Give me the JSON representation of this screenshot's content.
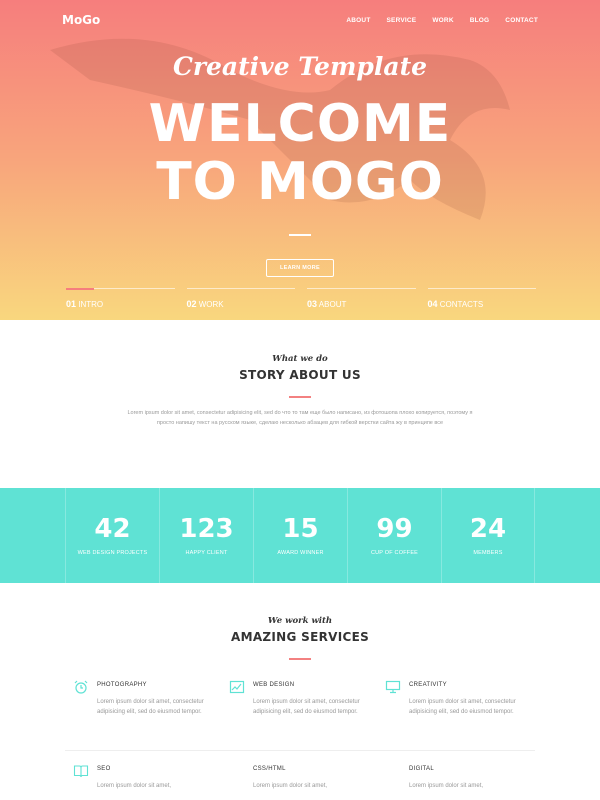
{
  "nav": {
    "logo": "MoGo",
    "items": [
      "ABOUT",
      "SERVICE",
      "WORK",
      "BLOG",
      "CONTACT"
    ]
  },
  "hero": {
    "subtitle": "Creative Template",
    "headline_line1": "WELCOME",
    "headline_line2": "TO MOGO",
    "button": "LEARN MORE",
    "slides": [
      {
        "num": "01",
        "label": "INTRO",
        "active": true
      },
      {
        "num": "02",
        "label": "WORK",
        "active": false
      },
      {
        "num": "03",
        "label": "ABOUT",
        "active": false
      },
      {
        "num": "04",
        "label": "CONTACTS",
        "active": false
      }
    ]
  },
  "about": {
    "script": "What we do",
    "title": "STORY ABOUT US",
    "text": "Lorem ipsum dolor sit amet, consectetur adipisicing elit, sed do что то там еще было написано, из фотошопа плохо копируется, поэтому я просто напишу текст на русском языке, сделаю несколько абзацев для гибкой верстки сайта жу в принципе все"
  },
  "stats": [
    {
      "num": "42",
      "caption": "WEB DESIGN PROJECTS"
    },
    {
      "num": "123",
      "caption": "HAPPY CLIENT"
    },
    {
      "num": "15",
      "caption": "AWARD WINNER"
    },
    {
      "num": "99",
      "caption": "CUP OF COFFEE"
    },
    {
      "num": "24",
      "caption": "MEMBERS"
    }
  ],
  "services": {
    "script": "We work with",
    "title": "AMAZING SERVICES",
    "items": [
      {
        "icon": "alarm-clock-icon",
        "title": "PHOTOGRAPHY",
        "desc": "Lorem ipsum dolor sit amet, consectetur adipisicing elit, sed do eiusmod tempor."
      },
      {
        "icon": "chart-icon",
        "title": "WEB DESIGN",
        "desc": "Lorem ipsum dolor sit amet, consectetur adipisicing elit, sed do eiusmod tempor."
      },
      {
        "icon": "monitor-icon",
        "title": "CREATIVITY",
        "desc": "Lorem ipsum dolor sit amet, consectetur adipisicing elit, sed do eiusmod tempor."
      },
      {
        "icon": "book-icon",
        "title": "SEO",
        "desc": "Lorem ipsum dolor sit amet,"
      },
      {
        "icon": "",
        "title": "CSS/HTML",
        "desc": "Lorem ipsum dolor sit amet,"
      },
      {
        "icon": "",
        "title": "DIGITAL",
        "desc": "Lorem ipsum dolor sit amet,"
      }
    ]
  },
  "colors": {
    "accent": "#f38181",
    "teal": "#5fe2d4",
    "gradient_top": "#f67e7d",
    "gradient_bottom": "#f9d77e"
  }
}
